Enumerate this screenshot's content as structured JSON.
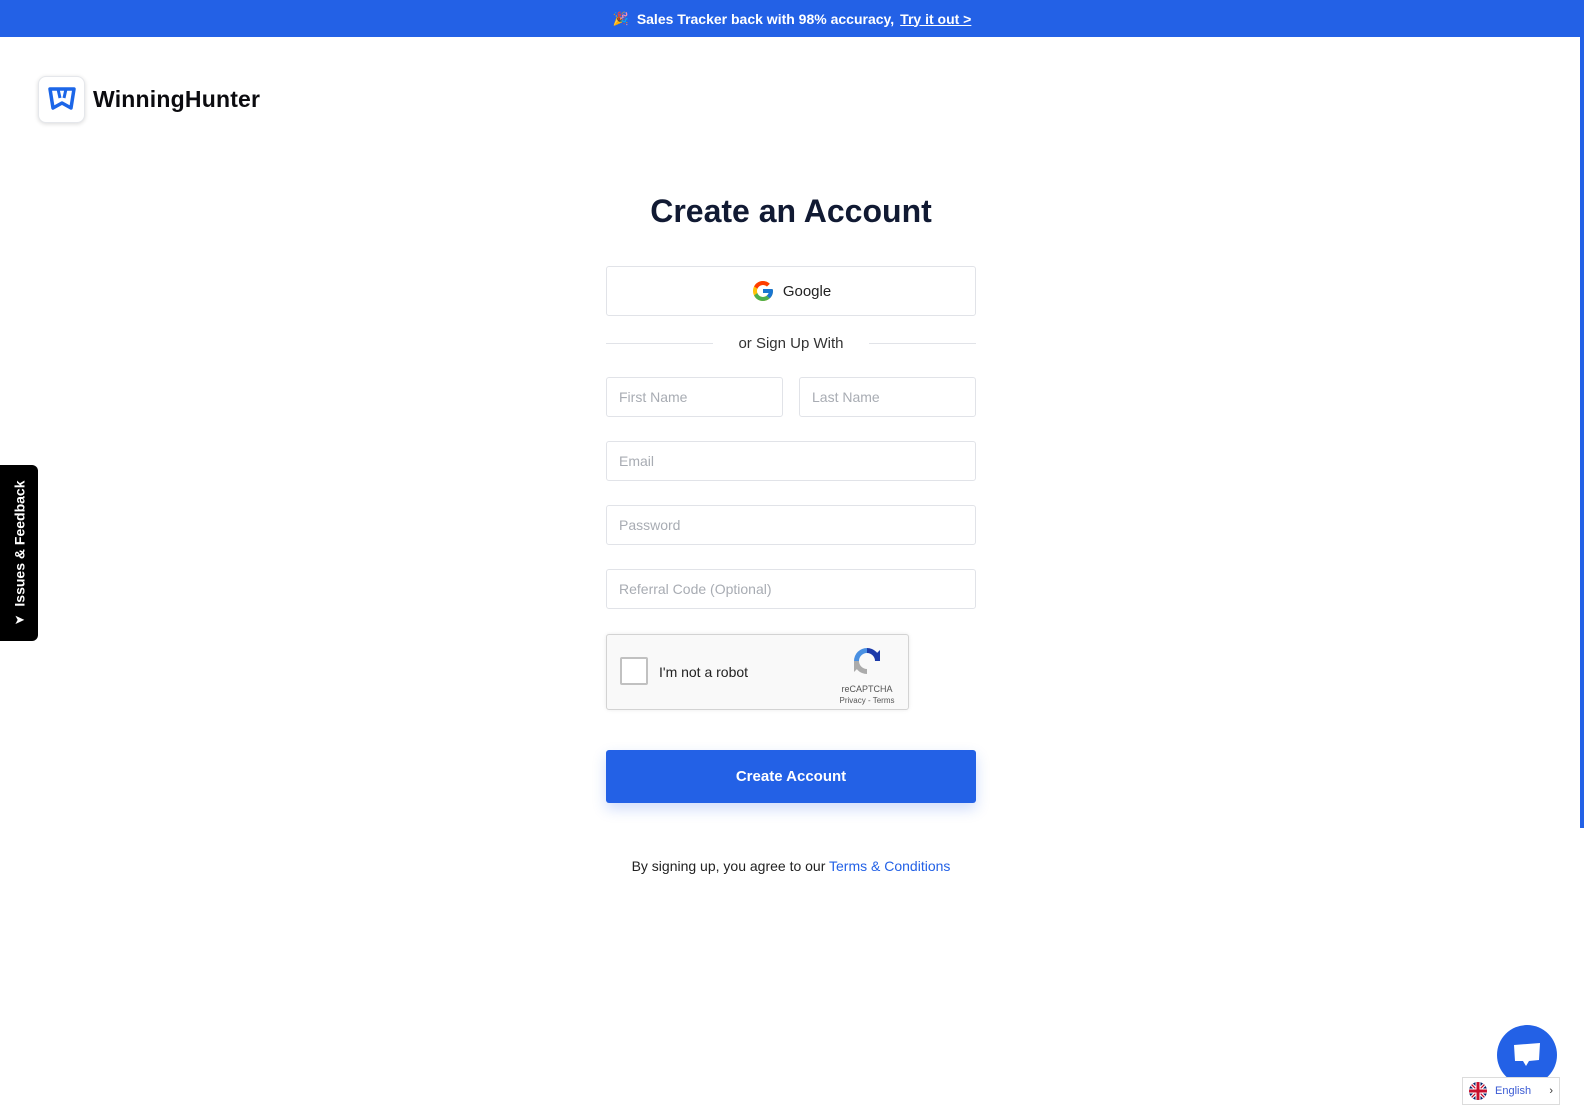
{
  "banner": {
    "icon": "party-popper-icon",
    "text": "Sales Tracker back with 98% accuracy,",
    "link": "Try it out >",
    "color": "#2361e6"
  },
  "brand": {
    "name": "WinningHunter"
  },
  "form": {
    "title": "Create an Account",
    "google_label": "Google",
    "divider_text": "or Sign Up With",
    "fields": {
      "first_name": {
        "placeholder": "First Name",
        "value": ""
      },
      "last_name": {
        "placeholder": "Last Name",
        "value": ""
      },
      "email": {
        "placeholder": "Email",
        "value": ""
      },
      "password": {
        "placeholder": "Password",
        "value": ""
      },
      "referral": {
        "placeholder": "Referral Code (Optional)",
        "value": ""
      }
    },
    "recaptcha": {
      "label": "I'm not a robot",
      "brand": "reCAPTCHA",
      "privacy": "Privacy",
      "separator": " - ",
      "terms": "Terms",
      "checked": false
    },
    "submit_label": "Create Account",
    "terms_prefix": "By signing up, you agree to our ",
    "terms_link": "Terms & Conditions"
  },
  "feedback_tab": {
    "label": "Issues & Feedback",
    "icon": "send-arrow-icon"
  },
  "chat": {
    "icon": "chat-bubble-icon"
  },
  "language": {
    "label": "English",
    "flag": "uk-flag-icon"
  }
}
